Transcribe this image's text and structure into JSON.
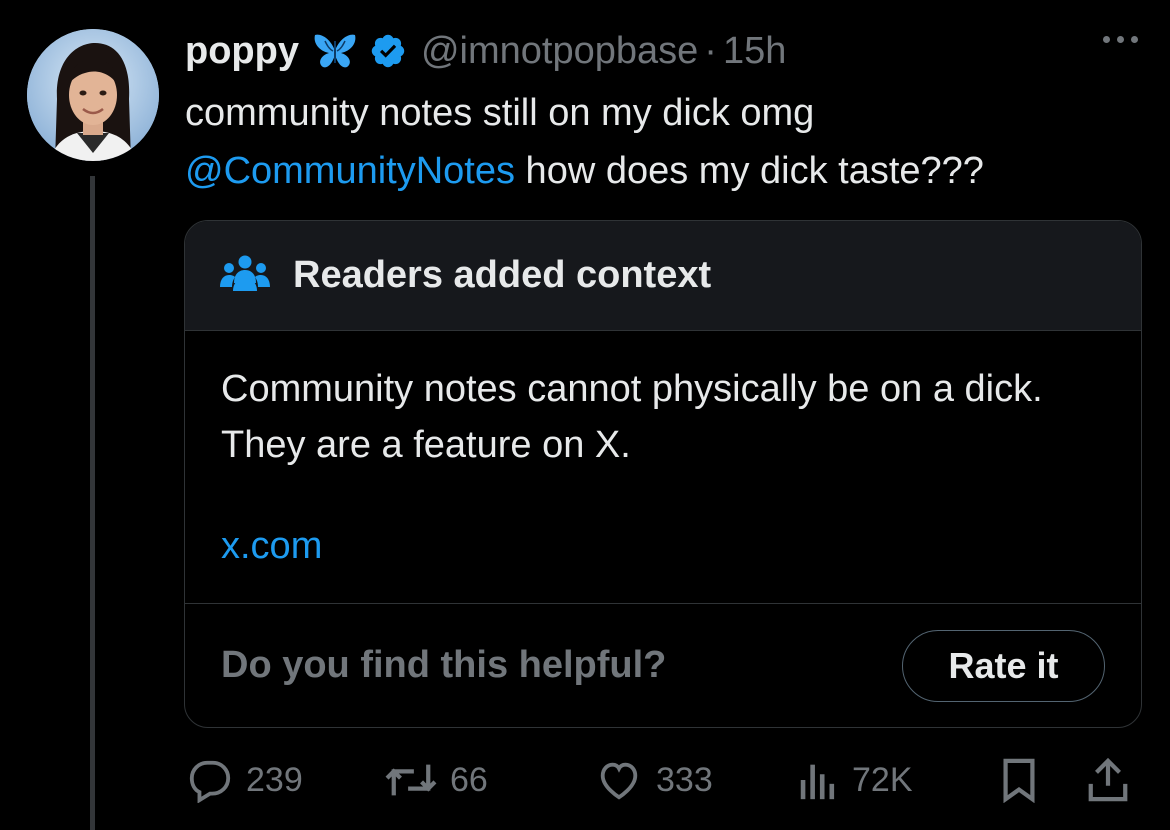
{
  "tweet": {
    "author_name": "poppy",
    "handle": "@imnotpopbase",
    "separator": "·",
    "time": "15h",
    "text_line1": "community notes still on my dick omg",
    "mention": "@CommunityNotes",
    "text_line2_rest": " how does my dick taste???"
  },
  "community_note": {
    "header_title": "Readers added context",
    "body_text": "Community notes cannot physically be on a dick. They are a feature on X.",
    "link_text": "x.com",
    "helpful_question": "Do you find this helpful?",
    "rate_button_label": "Rate it"
  },
  "actions": {
    "replies": "239",
    "reposts": "66",
    "likes": "333",
    "views": "72K"
  },
  "colors": {
    "background": "#000000",
    "text_primary": "#e7e9ea",
    "text_secondary": "#71767b",
    "accent": "#1d9bf0",
    "verified": "#1d9bf0",
    "card_border": "#2f3336",
    "card_header_bg": "#16181c"
  },
  "icons": [
    "butterfly-icon",
    "verified-badge-icon",
    "more-icon",
    "people-icon",
    "reply-icon",
    "repost-icon",
    "like-icon",
    "views-icon",
    "bookmark-icon",
    "share-icon"
  ]
}
